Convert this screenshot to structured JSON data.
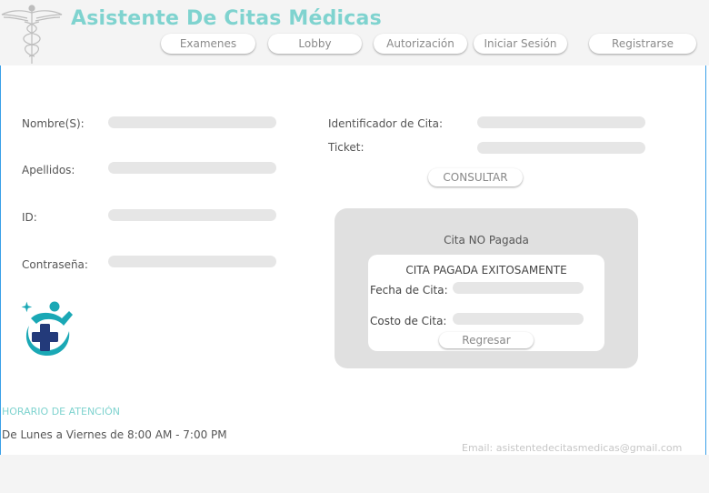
{
  "header": {
    "app_title": "Asistente De Citas Médicas",
    "nav": [
      {
        "label": "Examenes"
      },
      {
        "label": "Lobby"
      },
      {
        "label": "Autorización"
      },
      {
        "label": "Iniciar Sesión"
      },
      {
        "label": "Registrarse"
      }
    ]
  },
  "form": {
    "nombre_label": "Nombre(S):",
    "apellidos_label": "Apellidos:",
    "id_label": "ID:",
    "contrasena_label": "Contraseña:"
  },
  "consulta": {
    "identificador_label": "Identificador de Cita:",
    "ticket_label": "Ticket:",
    "consultar_label": "CONSULTAR"
  },
  "status_panel": {
    "title": "Cita NO Pagada",
    "card": {
      "title": "CITA PAGADA EXITOSAMENTE",
      "fecha_label": "Fecha de Cita:",
      "costo_label": "Costo de Cita:",
      "regresar_label": "Regresar"
    }
  },
  "footer": {
    "hours_title": "HORARIO DE ATENCIÓN",
    "hours_text": "De Lunes a Viernes de 8:00 AM - 7:00 PM",
    "email": "Email: asistentedecitasmedicas@gmail.com"
  },
  "colors": {
    "accent": "#7fd3cf",
    "frame": "#3aa0e8",
    "panel": "#e0e0e0",
    "logo_navy": "#233a7a",
    "logo_teal": "#1aa8b5"
  }
}
